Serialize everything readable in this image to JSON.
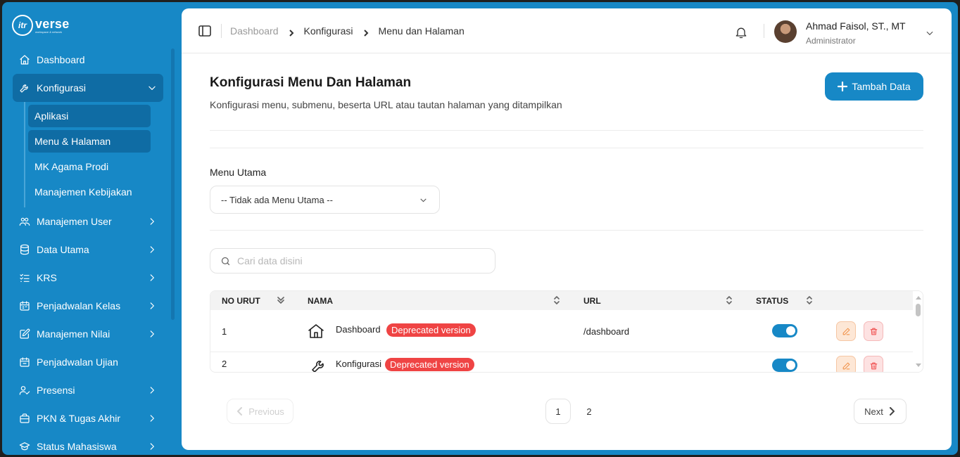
{
  "brand": {
    "logo_mark": "itr",
    "logo_word": "verse",
    "logo_sub": "workspace & network"
  },
  "sidebar": {
    "items": [
      {
        "label": "Dashboard",
        "icon": "home-icon"
      },
      {
        "label": "Konfigurasi",
        "icon": "wrench-icon",
        "expanded": true,
        "children": [
          "Aplikasi",
          "Menu & Halaman",
          "MK Agama Prodi",
          "Manajemen Kebijakan"
        ]
      },
      {
        "label": "Manajemen User",
        "icon": "users-icon"
      },
      {
        "label": "Data Utama",
        "icon": "database-icon"
      },
      {
        "label": "KRS",
        "icon": "checklist-icon"
      },
      {
        "label": "Penjadwalan Kelas",
        "icon": "calendar-icon"
      },
      {
        "label": "Manajemen Nilai",
        "icon": "edit-icon"
      },
      {
        "label": "Penjadwalan Ujian",
        "icon": "calendar-icon"
      },
      {
        "label": "Presensi",
        "icon": "user-check-icon"
      },
      {
        "label": "PKN & Tugas Akhir",
        "icon": "briefcase-icon"
      },
      {
        "label": "Status Mahasiswa",
        "icon": "graduation-icon"
      }
    ]
  },
  "topbar": {
    "breadcrumbs": [
      "Dashboard",
      "Konfigurasi",
      "Menu dan Halaman"
    ],
    "user_name": "Ahmad Faisol, ST., MT",
    "user_role": "Administrator"
  },
  "page": {
    "title": "Konfigurasi Menu Dan Halaman",
    "description": "Konfigurasi menu, submenu, beserta URL atau tautan halaman yang ditampilkan",
    "add_button": "Tambah Data"
  },
  "filter": {
    "label": "Menu Utama",
    "selected": "-- Tidak ada Menu Utama --"
  },
  "search": {
    "placeholder": "Cari data disini",
    "value": ""
  },
  "table": {
    "columns": [
      "NO URUT",
      "NAMA",
      "URL",
      "STATUS"
    ],
    "rows": [
      {
        "no": "1",
        "nama": "Dashboard",
        "badge": "Deprecated version",
        "url": "/dashboard",
        "icon": "home-icon",
        "status": true
      },
      {
        "no": "2",
        "nama": "Konfigurasi",
        "badge": "Deprecated version",
        "url": "",
        "icon": "wrench-icon",
        "status": true
      }
    ]
  },
  "pagination": {
    "prev": "Previous",
    "next": "Next",
    "pages": [
      "1",
      "2"
    ],
    "current": "1"
  },
  "colors": {
    "primary": "#1788c6",
    "badge": "#ef4444"
  }
}
